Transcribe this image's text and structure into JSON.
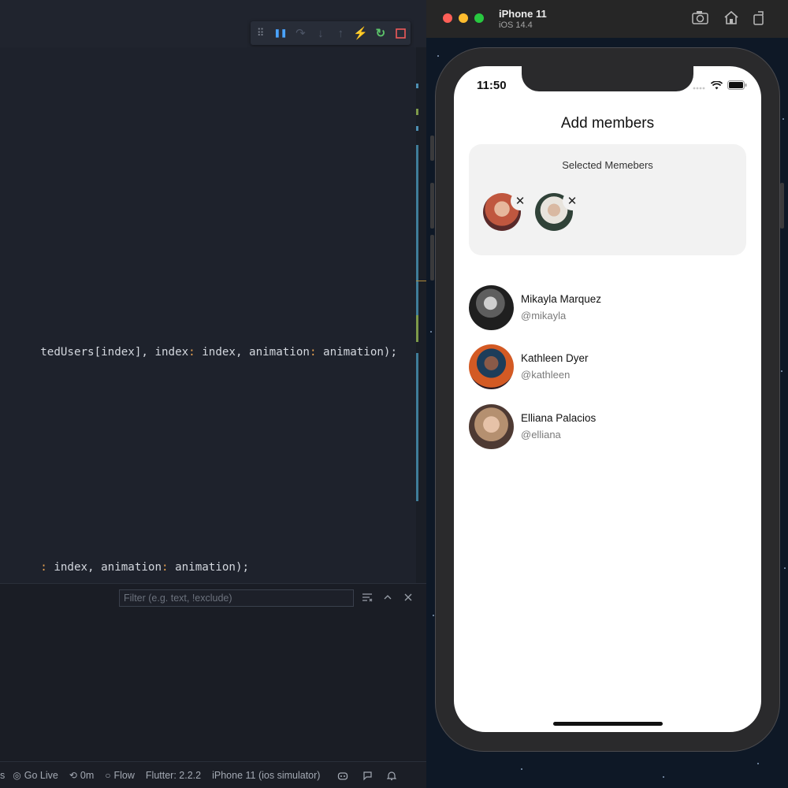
{
  "editor": {
    "debug_toolbar": {
      "icons": [
        "drag-handle-icon",
        "pause-icon",
        "step-over-icon",
        "step-into-icon",
        "step-out-icon",
        "hot-reload-icon",
        "hot-restart-icon",
        "stop-icon"
      ],
      "glyphs": [
        "⠿",
        "❚❚",
        "↷",
        "↓",
        "↑",
        "⚡",
        "↻",
        "▢"
      ],
      "colors": [
        "#7e8591",
        "#4aa3ff",
        "#4d5566",
        "#4d5566",
        "#4d5566",
        "#f0a830",
        "#5cc46a",
        "#ef5a5a"
      ]
    },
    "code_lines": {
      "line1_a": "tedUsers[index], index",
      "line1_b": ":",
      "line1_c": " index, animation",
      "line1_d": ":",
      "line1_e": " animation);",
      "line2_a": ":",
      "line2_b": " index, animation",
      "line2_c": ":",
      "line2_d": " animation);"
    },
    "panel": {
      "filter_placeholder": "Filter (e.g. text, !exclude)"
    },
    "statusbar": {
      "item0": "s",
      "go_live": "Go Live",
      "time": "0m",
      "flow": "Flow",
      "flutter": "Flutter: 2.2.2",
      "device": "iPhone 11 (ios simulator)"
    }
  },
  "simulator": {
    "device_name": "iPhone 11",
    "os_version": "iOS 14.4",
    "status_time": "11:50",
    "app_title": "Add members",
    "selected_title": "Selected Memebers",
    "selected_members": [
      {
        "avatar_color": "#b0473a"
      },
      {
        "avatar_color": "#3f5b4c"
      }
    ],
    "members": [
      {
        "name": "Mikayla Marquez",
        "handle": "@mikayla"
      },
      {
        "name": "Kathleen Dyer",
        "handle": "@kathleen"
      },
      {
        "name": "Elliana Palacios",
        "handle": "@elliana"
      }
    ]
  }
}
